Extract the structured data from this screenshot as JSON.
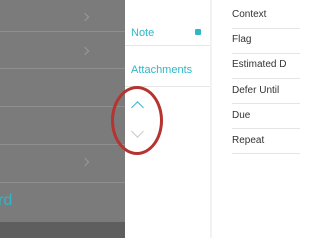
{
  "left_pane": {
    "bottom_text": "rd"
  },
  "middle_pane": {
    "items": [
      "Note",
      "Attachments"
    ]
  },
  "right_pane": {
    "fields": [
      "Context",
      "Flag",
      "Estimated D",
      "Defer Until",
      "Due",
      "Repeat"
    ]
  },
  "colors": {
    "accent": "#2fb7c8",
    "highlight_ring": "#b5342f",
    "overlay": "#7b7b7b"
  }
}
